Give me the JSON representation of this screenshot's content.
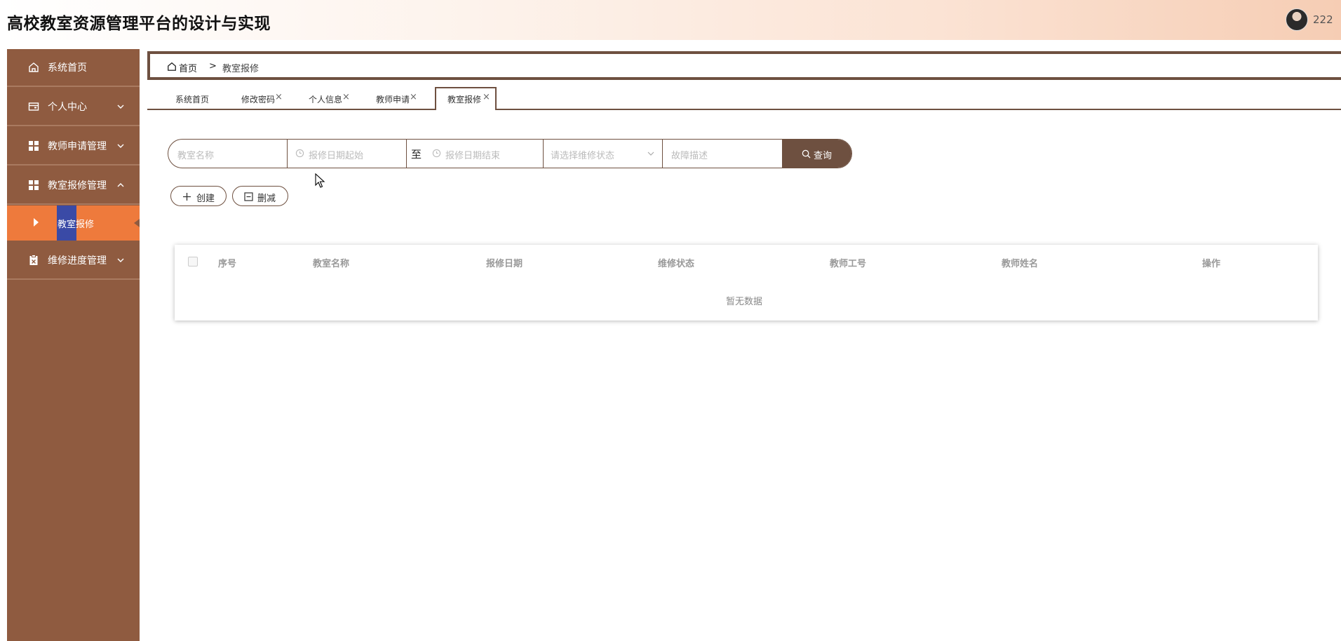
{
  "app": {
    "title": "高校教室资源管理平台的设计与实现",
    "username": "222"
  },
  "sidebar": {
    "items": [
      {
        "label": "系统首页",
        "icon": "home-icon"
      },
      {
        "label": "个人中心",
        "icon": "wallet-icon"
      },
      {
        "label": "教师申请管理",
        "icon": "grid-icon"
      },
      {
        "label": "教室报修管理",
        "icon": "grid-icon",
        "expanded": true
      },
      {
        "label": "维修进度管理",
        "icon": "clipboard-icon"
      }
    ],
    "sub_active": "教室报修"
  },
  "breadcrumb": {
    "home": "首页",
    "separator": ">",
    "current": "教室报修"
  },
  "tabs": [
    {
      "label": "系统首页",
      "closable": false
    },
    {
      "label": "修改密码",
      "closable": true
    },
    {
      "label": "个人信息",
      "closable": true
    },
    {
      "label": "教师申请",
      "closable": true
    },
    {
      "label": "教室报修",
      "closable": true,
      "active": true
    }
  ],
  "tab_close": "×",
  "search": {
    "classroom_placeholder": "教室名称",
    "date_start_placeholder": "报修日期起始",
    "to_label": "至",
    "date_end_placeholder": "报修日期结束",
    "status_placeholder": "请选择维修状态",
    "fault_placeholder": "故障描述",
    "query_label": "查询"
  },
  "actions": {
    "create_label": "创建",
    "delete_label": "删减"
  },
  "table": {
    "columns": [
      "序号",
      "教室名称",
      "报修日期",
      "维修状态",
      "教师工号",
      "教师姓名",
      "操作"
    ],
    "empty_text": "暂无数据"
  },
  "colors": {
    "sidebar": "#8f5b40",
    "accent": "#ee7a3c",
    "primary_dark": "#6e5040"
  }
}
